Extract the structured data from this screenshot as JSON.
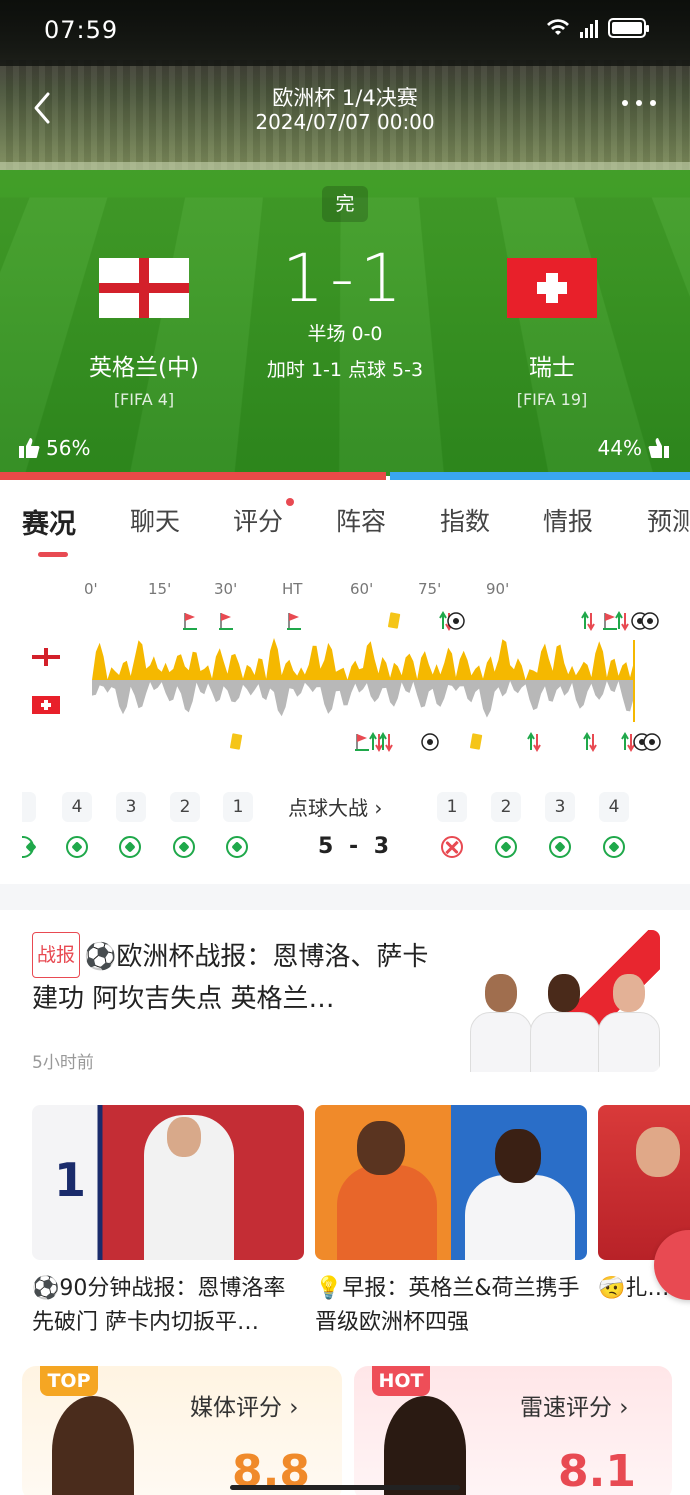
{
  "status_bar": {
    "time": "07:59",
    "network": "2G"
  },
  "header": {
    "title": "欧洲杯 1/4决赛",
    "date": "2024/07/07 00:00",
    "state": "完"
  },
  "match": {
    "score": "1-1",
    "halftime": "半场 0-0",
    "extra": "加时 1-1 点球 5-3",
    "home": {
      "name": "英格兰(中)",
      "rank": "[FIFA 4]",
      "flag": "england-flag"
    },
    "away": {
      "name": "瑞士",
      "rank": "[FIFA 19]",
      "flag": "switzerland-flag"
    }
  },
  "votes": {
    "home": "56%",
    "away": "44%",
    "home_fraction": 0.56,
    "home_color": "#ea4a48",
    "away_color": "#3aa6f0"
  },
  "tabs": [
    {
      "label": "赛况",
      "active": true
    },
    {
      "label": "聊天"
    },
    {
      "label": "评分",
      "dot": true
    },
    {
      "label": "阵容"
    },
    {
      "label": "指数"
    },
    {
      "label": "情报"
    },
    {
      "label": "预测"
    }
  ],
  "timeline": {
    "ticks": [
      "0'",
      "15'",
      "30'",
      "HT",
      "60'",
      "75'",
      "90'"
    ]
  },
  "penalties": {
    "title": "点球大战",
    "score_home": "5",
    "score_away": "3",
    "home_numbers": [
      "4",
      "3",
      "2",
      "1"
    ],
    "away_numbers": [
      "1",
      "2",
      "3",
      "4"
    ],
    "away_results": [
      "miss",
      "scored",
      "scored",
      "scored"
    ]
  },
  "article": {
    "badge": "战报",
    "title": "⚽欧洲杯战报：恩博洛、萨卡建功 阿坎吉失点 英格兰…",
    "time": "5小时前"
  },
  "videos": [
    {
      "title": "⚽90分钟战报：恩博洛率先破门 萨卡内切扳平…"
    },
    {
      "title": "💡早报：英格兰&荷兰携手晋级欧洲杯四强"
    },
    {
      "title": "🤕扎…出了内收"
    }
  ],
  "ratings": {
    "media": {
      "tag": "TOP",
      "title": "媒体评分",
      "score": "8.8"
    },
    "speed": {
      "tag": "HOT",
      "title": "雷速评分",
      "score": "8.1"
    }
  },
  "colors": {
    "accent": "#e84a52",
    "gold": "#f5b800",
    "grey_wave": "#b8b8b8"
  }
}
